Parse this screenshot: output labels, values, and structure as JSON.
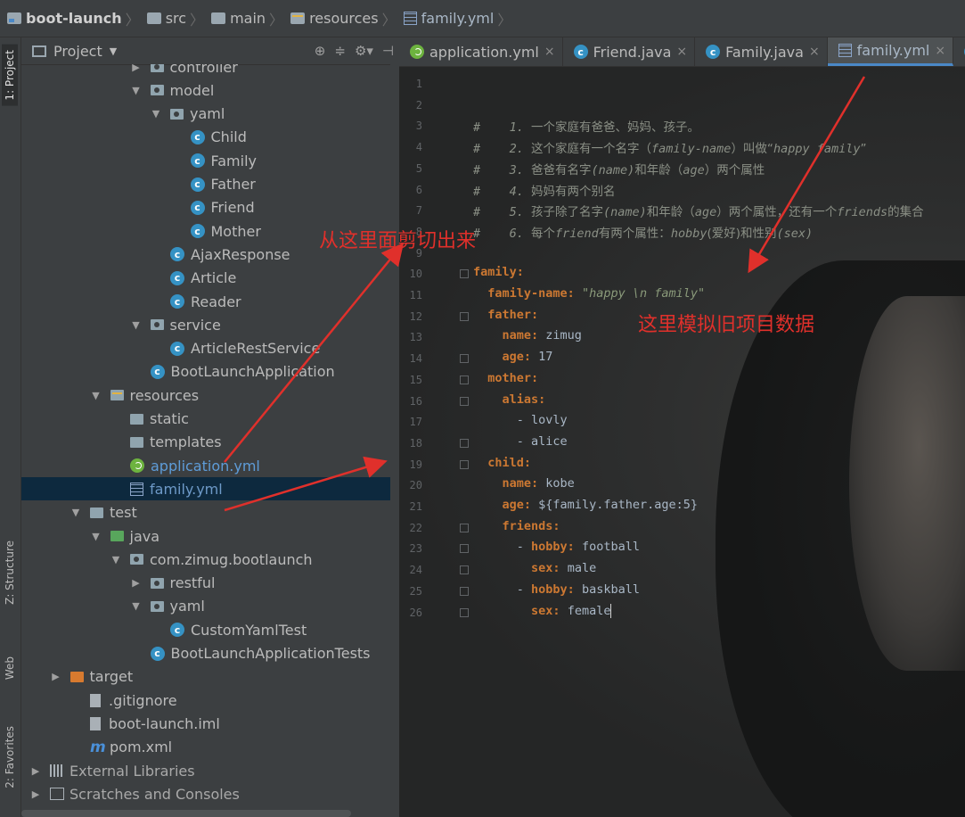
{
  "breadcrumb": {
    "items": [
      "boot-launch",
      "src",
      "main",
      "resources",
      "family.yml"
    ]
  },
  "leftbar": {
    "tabs": [
      "1: Project",
      "Z: Structure",
      "Web",
      "2: Favorites"
    ]
  },
  "panel": {
    "title": "Project",
    "tree": [
      {
        "label": "controller",
        "kind": "package",
        "depth": 5,
        "arrow": "right"
      },
      {
        "label": "model",
        "kind": "package",
        "depth": 5,
        "arrow": "down"
      },
      {
        "label": "yaml",
        "kind": "package",
        "depth": 6,
        "arrow": "down"
      },
      {
        "label": "Child",
        "kind": "class",
        "depth": 7
      },
      {
        "label": "Family",
        "kind": "class",
        "depth": 7
      },
      {
        "label": "Father",
        "kind": "class",
        "depth": 7
      },
      {
        "label": "Friend",
        "kind": "class",
        "depth": 7
      },
      {
        "label": "Mother",
        "kind": "class",
        "depth": 7
      },
      {
        "label": "AjaxResponse",
        "kind": "class",
        "depth": 6
      },
      {
        "label": "Article",
        "kind": "class",
        "depth": 6
      },
      {
        "label": "Reader",
        "kind": "class",
        "depth": 6
      },
      {
        "label": "service",
        "kind": "package",
        "depth": 5,
        "arrow": "down"
      },
      {
        "label": "ArticleRestService",
        "kind": "class",
        "depth": 6
      },
      {
        "label": "BootLaunchApplication",
        "kind": "class",
        "depth": 5
      },
      {
        "label": "resources",
        "kind": "resfolder",
        "depth": 3,
        "arrow": "down"
      },
      {
        "label": "static",
        "kind": "folder",
        "depth": 4
      },
      {
        "label": "templates",
        "kind": "folder",
        "depth": 4
      },
      {
        "label": "application.yml",
        "kind": "spring",
        "depth": 4
      },
      {
        "label": "family.yml",
        "kind": "yml",
        "depth": 4,
        "selected": true
      },
      {
        "label": "test",
        "kind": "folder",
        "depth": 2,
        "arrow": "down"
      },
      {
        "label": "java",
        "kind": "greenfolder",
        "depth": 3,
        "arrow": "down"
      },
      {
        "label": "com.zimug.bootlaunch",
        "kind": "package",
        "depth": 4,
        "arrow": "down"
      },
      {
        "label": "restful",
        "kind": "package",
        "depth": 5,
        "arrow": "right"
      },
      {
        "label": "yaml",
        "kind": "package",
        "depth": 5,
        "arrow": "down"
      },
      {
        "label": "CustomYamlTest",
        "kind": "class",
        "depth": 6
      },
      {
        "label": "BootLaunchApplicationTests",
        "kind": "class",
        "depth": 5
      },
      {
        "label": "target",
        "kind": "orangefolder",
        "depth": 1,
        "arrow": "right"
      },
      {
        "label": ".gitignore",
        "kind": "file",
        "depth": 2
      },
      {
        "label": "boot-launch.iml",
        "kind": "file",
        "depth": 2
      },
      {
        "label": "pom.xml",
        "kind": "maven",
        "depth": 2
      },
      {
        "label": "External Libraries",
        "kind": "lib",
        "depth": 0,
        "arrow": "right"
      },
      {
        "label": "Scratches and Consoles",
        "kind": "scratch",
        "depth": 0,
        "arrow": "right"
      }
    ]
  },
  "editor": {
    "tabs": [
      {
        "label": "application.yml",
        "kind": "spring",
        "active": false
      },
      {
        "label": "Friend.java",
        "kind": "class",
        "active": false
      },
      {
        "label": "Family.java",
        "kind": "class",
        "active": false
      },
      {
        "label": "family.yml",
        "kind": "yml",
        "active": true
      },
      {
        "label": "C",
        "kind": "class",
        "active": false,
        "partial": true
      }
    ],
    "lines": [
      {
        "n": "1",
        "html": ""
      },
      {
        "n": "2",
        "html": ""
      },
      {
        "n": "3",
        "html": "<span class='cm'>#    1. <span class='cn'>一个家庭有爸爸、妈妈、孩子。</span></span>"
      },
      {
        "n": "4",
        "html": "<span class='cm'>#    2. <span class='cn'>这个家庭有一个名字（</span>family-name<span class='cn'>）叫做“</span>happy family<span class='cn'>”</span></span>"
      },
      {
        "n": "5",
        "html": "<span class='cm'>#    3. <span class='cn'>爸爸有名字</span>(name)<span class='cn'>和年龄（</span>age<span class='cn'>）两个属性</span></span>"
      },
      {
        "n": "6",
        "html": "<span class='cm'>#    4. <span class='cn'>妈妈有两个别名</span></span>"
      },
      {
        "n": "7",
        "html": "<span class='cm'>#    5. <span class='cn'>孩子除了名字</span>(name)<span class='cn'>和年龄（</span>age<span class='cn'>）两个属性，还有一个</span>friends<span class='cn'>的集合</span></span>"
      },
      {
        "n": "8",
        "html": "<span class='cm'>#    6. <span class='cn'>每个</span>friend<span class='cn'>有两个属性：</span>hobby<span class='cn'>(爱好)和性别</span>(sex)</span>"
      },
      {
        "n": "9",
        "html": ""
      },
      {
        "n": "10",
        "html": "<span class='k'>family:</span>"
      },
      {
        "n": "11",
        "html": "  <span class='k'>family-name:</span> <span class='s'>\"happy \\n family\"</span>"
      },
      {
        "n": "12",
        "html": "  <span class='k'>father:</span>"
      },
      {
        "n": "13",
        "html": "    <span class='k'>name:</span> <span class='v'>zimug</span>"
      },
      {
        "n": "14",
        "html": "    <span class='k'>age:</span> <span class='v'>17</span>"
      },
      {
        "n": "15",
        "html": "  <span class='k'>mother:</span>"
      },
      {
        "n": "16",
        "html": "    <span class='k'>alias:</span>"
      },
      {
        "n": "17",
        "html": "      <span class='v'>- lovly</span>"
      },
      {
        "n": "18",
        "html": "      <span class='v'>- alice</span>"
      },
      {
        "n": "19",
        "html": "  <span class='k'>child:</span>"
      },
      {
        "n": "20",
        "html": "    <span class='k'>name:</span> <span class='v'>kobe</span>"
      },
      {
        "n": "21",
        "html": "    <span class='k'>age:</span> <span class='v'>${family.father.age:5}</span>"
      },
      {
        "n": "22",
        "html": "    <span class='k'>friends:</span>"
      },
      {
        "n": "23",
        "html": "      <span class='v'>- </span><span class='k'>hobby:</span> <span class='v'>football</span>"
      },
      {
        "n": "24",
        "html": "        <span class='k'>sex:</span> <span class='v'>male</span>"
      },
      {
        "n": "25",
        "html": "      <span class='v'>- </span><span class='k'>hobby:</span> <span class='v'>baskball</span>"
      },
      {
        "n": "26",
        "html": "        <span class='k'>sex:</span> <span class='v'>female</span><span class='caret'></span>"
      }
    ],
    "fold_lines": [
      10,
      12,
      14,
      15,
      16,
      18,
      19,
      22,
      23,
      24,
      25,
      26
    ]
  },
  "annotations": {
    "cut_note": "从这里面剪切出来",
    "data_note": "这里模拟旧项目数据",
    "color": "#e0302b"
  }
}
